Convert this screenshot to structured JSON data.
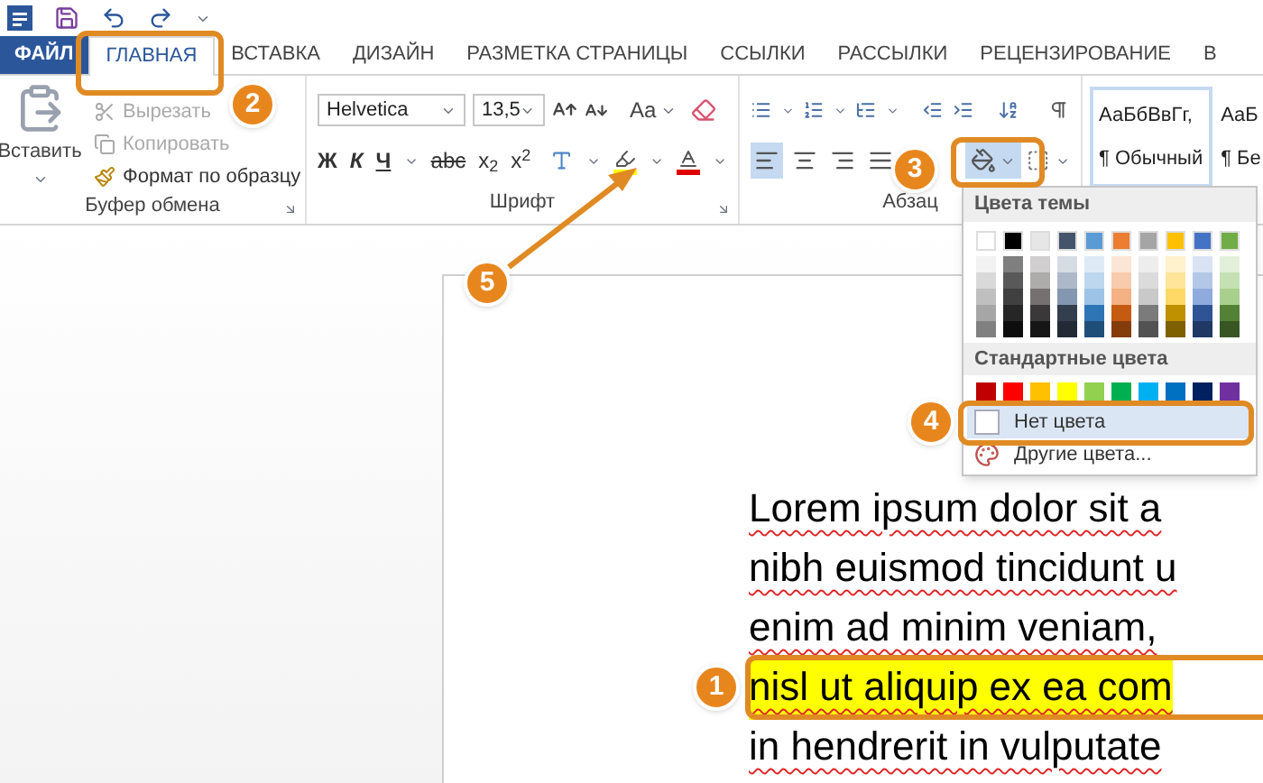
{
  "tabs": [
    {
      "label": "ФАЙЛ",
      "kind": "file",
      "selected": false
    },
    {
      "label": "ГЛАВНАЯ",
      "kind": "tab",
      "selected": true
    },
    {
      "label": "ВСТАВКА",
      "kind": "tab",
      "selected": false
    },
    {
      "label": "ДИЗАЙН",
      "kind": "tab",
      "selected": false
    },
    {
      "label": "РАЗМЕТКА СТРАНИЦЫ",
      "kind": "tab",
      "selected": false
    },
    {
      "label": "ССЫЛКИ",
      "kind": "tab",
      "selected": false
    },
    {
      "label": "РАССЫЛКИ",
      "kind": "tab",
      "selected": false
    },
    {
      "label": "РЕЦЕНЗИРОВАНИЕ",
      "kind": "tab",
      "selected": false
    },
    {
      "label": "В",
      "kind": "tab",
      "selected": false
    }
  ],
  "clipboard": {
    "label": "Буфер обмена",
    "paste": "Вставить",
    "items": [
      {
        "label": "Вырезать",
        "kind": "cut",
        "disabled": true
      },
      {
        "label": "Копировать",
        "kind": "copy",
        "disabled": true
      },
      {
        "label": "Формат по образцу",
        "kind": "format",
        "disabled": false
      }
    ]
  },
  "font": {
    "label": "Шрифт",
    "font_name": "Helvetica",
    "font_size": "13,5",
    "case_button": "Aa",
    "format_buttons": [
      {
        "label": "Ж",
        "kind": "bold"
      },
      {
        "label": "К",
        "kind": "italic"
      },
      {
        "label": "Ч",
        "kind": "underline"
      },
      {
        "label": "abc",
        "kind": "strike"
      },
      {
        "label": "x$_{2}$",
        "kind": "script"
      },
      {
        "label": "x$^{2}$",
        "kind": "script"
      }
    ]
  },
  "paragraph": {
    "label": "Абзац",
    "alignments": [
      {
        "kind": "left",
        "selected": true
      },
      {
        "kind": "center",
        "selected": false
      },
      {
        "kind": "right",
        "selected": false
      },
      {
        "kind": "justify",
        "selected": false
      }
    ],
    "shading_selected": true
  },
  "styles": [
    {
      "sample": "АаБбВвГг,",
      "name": "¶ Обычный",
      "selected": true
    },
    {
      "sample": "АаБ",
      "name": "¶ Бе",
      "selected": false
    }
  ],
  "color_menu": {
    "theme_title": "Цвета темы",
    "theme_colors": [
      {
        "color": "#ffffff",
        "shades": [
          {
            "color": "#f2f2f2"
          },
          {
            "color": "#d9d9d9"
          },
          {
            "color": "#bfbfbf"
          },
          {
            "color": "#a6a6a6"
          },
          {
            "color": "#808080"
          }
        ]
      },
      {
        "color": "#000000",
        "shades": [
          {
            "color": "#7f7f7f"
          },
          {
            "color": "#595959"
          },
          {
            "color": "#404040"
          },
          {
            "color": "#262626"
          },
          {
            "color": "#0d0d0d"
          }
        ]
      },
      {
        "color": "#e7e6e6",
        "shades": [
          {
            "color": "#d0cece"
          },
          {
            "color": "#aeabab"
          },
          {
            "color": "#757171"
          },
          {
            "color": "#3a3838"
          },
          {
            "color": "#171616"
          }
        ]
      },
      {
        "color": "#44546a",
        "shades": [
          {
            "color": "#d6dce4"
          },
          {
            "color": "#adb9ca"
          },
          {
            "color": "#8497b0"
          },
          {
            "color": "#333f4f"
          },
          {
            "color": "#222a35"
          }
        ]
      },
      {
        "color": "#5b9bd5",
        "shades": [
          {
            "color": "#deebf6"
          },
          {
            "color": "#bdd7ee"
          },
          {
            "color": "#9dc3e6"
          },
          {
            "color": "#2e75b5"
          },
          {
            "color": "#1f4e79"
          }
        ]
      },
      {
        "color": "#ed7d31",
        "shades": [
          {
            "color": "#fbe5d5"
          },
          {
            "color": "#f7cbac"
          },
          {
            "color": "#f4b183"
          },
          {
            "color": "#c55a11"
          },
          {
            "color": "#843c0b"
          }
        ]
      },
      {
        "color": "#a5a5a5",
        "shades": [
          {
            "color": "#ededed"
          },
          {
            "color": "#dbdbdb"
          },
          {
            "color": "#c9c9c9"
          },
          {
            "color": "#7b7b7b"
          },
          {
            "color": "#525252"
          }
        ]
      },
      {
        "color": "#ffc000",
        "shades": [
          {
            "color": "#fff2cc"
          },
          {
            "color": "#fee599"
          },
          {
            "color": "#ffd965"
          },
          {
            "color": "#bf9000"
          },
          {
            "color": "#7f6000"
          }
        ]
      },
      {
        "color": "#4472c4",
        "shades": [
          {
            "color": "#dae3f3"
          },
          {
            "color": "#b4c7e7"
          },
          {
            "color": "#8faadc"
          },
          {
            "color": "#2f5496"
          },
          {
            "color": "#1f3864"
          }
        ]
      },
      {
        "color": "#70ad47",
        "shades": [
          {
            "color": "#e2efd9"
          },
          {
            "color": "#c5e0b3"
          },
          {
            "color": "#a8d08d"
          },
          {
            "color": "#538135"
          },
          {
            "color": "#375623"
          }
        ]
      }
    ],
    "standard_title": "Стандартные цвета",
    "standard_colors": [
      {
        "color": "#c00000"
      },
      {
        "color": "#ff0000"
      },
      {
        "color": "#ffc000"
      },
      {
        "color": "#ffff00"
      },
      {
        "color": "#92d050"
      },
      {
        "color": "#00b050"
      },
      {
        "color": "#00b0f0"
      },
      {
        "color": "#0070c0"
      },
      {
        "color": "#002060"
      },
      {
        "color": "#7030a0"
      }
    ],
    "items": [
      {
        "label": "Нет цвета",
        "kind": "no-color",
        "selected": true
      },
      {
        "label": "Другие цвета...",
        "kind": "more",
        "selected": false
      }
    ]
  },
  "document": {
    "lines": [
      {
        "text": "Lorem ipsum dolor sit a",
        "highlighted": false
      },
      {
        "text": "nibh euismod tincidunt u",
        "highlighted": false
      },
      {
        "text": "enim ad minim veniam,",
        "highlighted": false
      },
      {
        "text": "nisl ut aliquip ex ea com",
        "highlighted": true
      },
      {
        "text": "in hendrerit in vulputate",
        "highlighted": false
      }
    ]
  },
  "callouts": [
    {
      "number": "1"
    },
    {
      "number": "2"
    },
    {
      "number": "3"
    },
    {
      "number": "4"
    },
    {
      "number": "5"
    }
  ]
}
